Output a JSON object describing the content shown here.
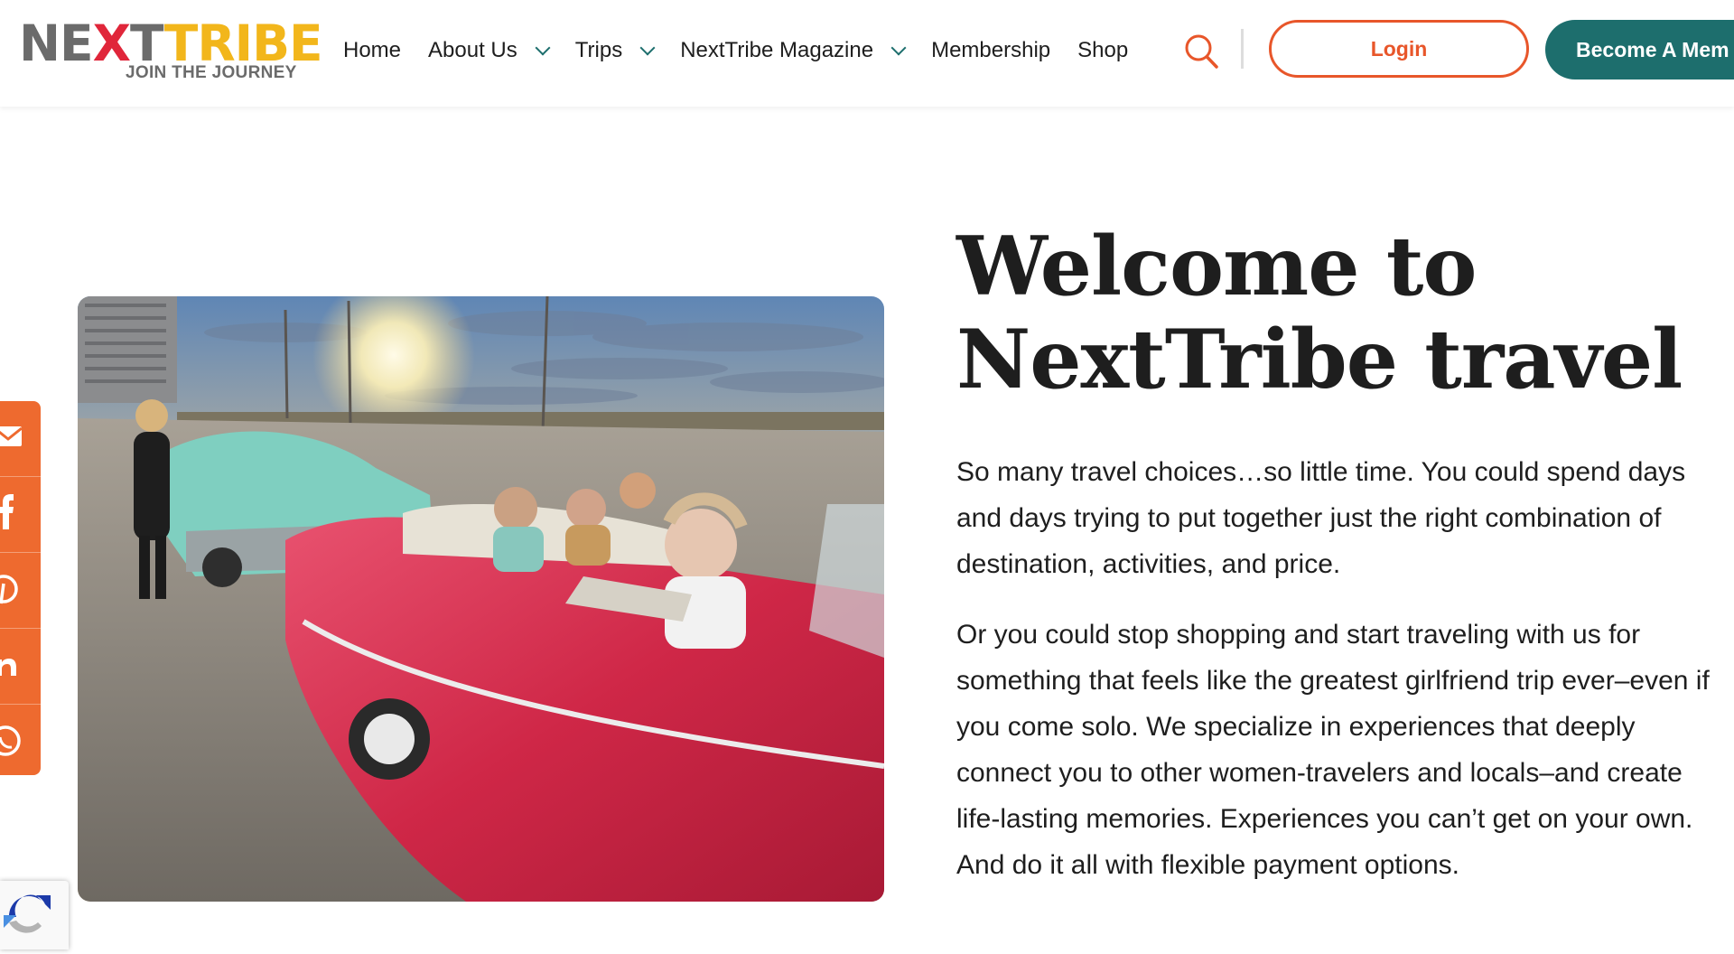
{
  "header": {
    "logo": {
      "brand_part1": "NE",
      "brand_x": "X",
      "brand_part2": "T",
      "brand_part3": "TRIBE",
      "tagline": "JOIN THE JOURNEY"
    },
    "nav": [
      {
        "label": "Home",
        "has_dropdown": false
      },
      {
        "label": "About Us",
        "has_dropdown": true
      },
      {
        "label": "Trips",
        "has_dropdown": true
      },
      {
        "label": "NextTribe Magazine",
        "has_dropdown": true
      },
      {
        "label": "Membership",
        "has_dropdown": false
      },
      {
        "label": "Shop",
        "has_dropdown": false
      }
    ],
    "search_icon": "search-icon",
    "login_label": "Login",
    "become_label": "Become A Mem"
  },
  "main": {
    "title": "Welcome to NextTribe travel",
    "paragraph1": "So many travel choices…so little time. You could spend days and days trying to put together just the right combination of destination, activities, and price.",
    "paragraph2": "Or you could stop shopping and start traveling with us for something that feels like the greatest girlfriend trip ever–even if you come solo. We specialize in experiences that deeply connect you to other women-travelers and locals–and create life-lasting memories. Experiences you can’t get on your own. And do it all with flexible payment options."
  },
  "share_bar": {
    "icons": [
      "email-icon",
      "facebook-icon",
      "pinterest-icon",
      "linkedin-icon",
      "whatsapp-icon"
    ]
  },
  "colors": {
    "orange": "#e8562a",
    "teal": "#1d6e6d",
    "logo_gray": "#6b6b6b",
    "logo_red": "#e0263a",
    "logo_yellow": "#f2b61b",
    "share_orange": "#ee6a2f"
  }
}
